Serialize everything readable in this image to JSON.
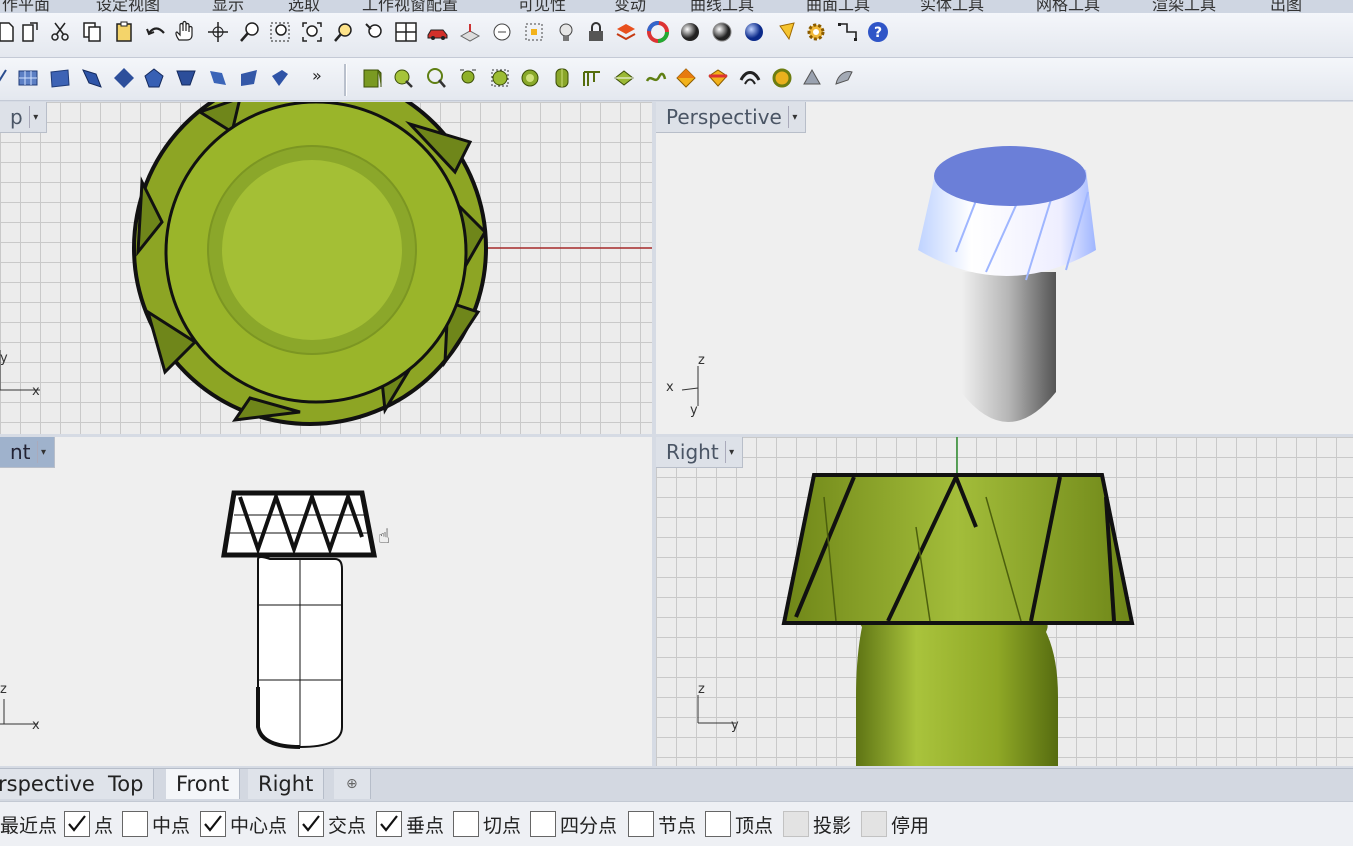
{
  "menu_tabs": [
    "作平面",
    "设定视图",
    "显示",
    "选取",
    "工作视窗配置",
    "可见性",
    "变动",
    "曲线工具",
    "曲面工具",
    "实体工具",
    "网格工具",
    "渲染工具",
    "出图"
  ],
  "toolbar1_icons": [
    "new-file-icon",
    "template-icon",
    "cut-icon",
    "copy-icon",
    "paste-icon",
    "undo-icon",
    "pan-hand-icon",
    "rotate-view-icon",
    "zoom-icon",
    "zoom-window-icon",
    "zoom-extents-icon",
    "zoom-selected-icon",
    "zoom-dynamic-icon",
    "four-viewports-icon",
    "car-render-icon",
    "named-view-icon",
    "cplane-icon",
    "snap-grid-icon",
    "light-bulb-icon",
    "lock-icon",
    "layer-icon",
    "color-wheel-icon",
    "shaded-sphere-icon",
    "rendered-sphere-icon",
    "blue-sphere-icon",
    "highlight-icon",
    "settings-gear-icon",
    "polyline-select-icon",
    "help-icon"
  ],
  "toolbar2_icons": [
    "surface-from-curves-icon",
    "surface-grid-icon",
    "surface-patch-icon",
    "surface-sweep-icon",
    "surface-network-icon",
    "surface-pentagon-icon",
    "surface-loft-icon",
    "surface-blend-icon",
    "surface-extend-icon",
    "surface-fillet-icon"
  ],
  "toolbar2b_icons": [
    "solid-box-icon",
    "solid-cylinder-icon",
    "solid-sphere-icon",
    "solid-cone-icon",
    "solid-torus-icon",
    "solid-pipe-icon",
    "solid-extrude-icon",
    "solid-union-icon",
    "solid-difference-icon",
    "solid-intersect-icon",
    "solid-fillet-icon",
    "solid-shell-icon",
    "solid-cap-icon",
    "solid-offset-icon",
    "solid-explode-icon",
    "solid-split-icon"
  ],
  "more_label": "»",
  "viewports": {
    "top": {
      "label": "p",
      "axis_y": "y",
      "axis_x": "x"
    },
    "perspective": {
      "label": "Perspective",
      "axis_z": "z",
      "axis_x": "x",
      "axis_y": "y"
    },
    "front": {
      "label": "nt",
      "axis_z": "z",
      "axis_x": "x"
    },
    "right": {
      "label": "Right",
      "axis_z": "z",
      "axis_y": "y"
    }
  },
  "bottom_tabs": {
    "perspective": "rspective",
    "top": "Top",
    "front": "Front",
    "right": "Right",
    "add": "⊕",
    "active": "front"
  },
  "osnaps": [
    {
      "label": "最近点",
      "checked": null,
      "disabled": false
    },
    {
      "label": "点",
      "checked": true,
      "disabled": false
    },
    {
      "label": "中点",
      "checked": false,
      "disabled": false
    },
    {
      "label": "中心点",
      "checked": true,
      "disabled": false
    },
    {
      "label": "交点",
      "checked": true,
      "disabled": false
    },
    {
      "label": "垂点",
      "checked": true,
      "disabled": false
    },
    {
      "label": "切点",
      "checked": false,
      "disabled": false
    },
    {
      "label": "四分点",
      "checked": false,
      "disabled": false
    },
    {
      "label": "节点",
      "checked": false,
      "disabled": false
    },
    {
      "label": "顶点",
      "checked": false,
      "disabled": false
    },
    {
      "label": "投影",
      "checked": false,
      "disabled": true
    },
    {
      "label": "停用",
      "checked": false,
      "disabled": true
    }
  ],
  "colors": {
    "accent": "#3a5ba0",
    "model_green": "#9cb231",
    "top_face_blue": "#6b7fd8"
  }
}
